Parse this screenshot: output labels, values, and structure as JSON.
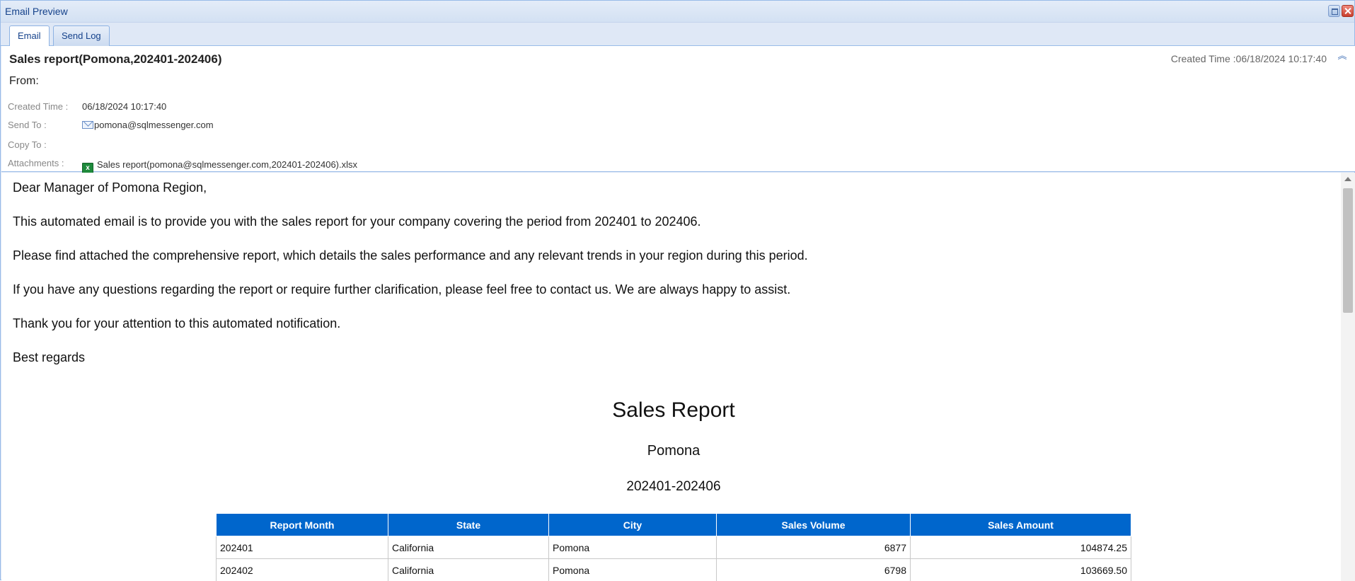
{
  "window": {
    "title": "Email Preview"
  },
  "tabs": [
    {
      "label": "Email",
      "active": true
    },
    {
      "label": "Send Log",
      "active": false
    }
  ],
  "header": {
    "subject": "Sales report(Pomona,202401-202406)",
    "created_right": "Created Time :06/18/2024 10:17:40",
    "from_label": "From:",
    "created_label": "Created Time :",
    "created_value": "06/18/2024 10:17:40",
    "send_to_label": "Send To :",
    "send_to_value": "pomona@sqlmessenger.com",
    "copy_to_label": "Copy To :",
    "copy_to_value": "",
    "attachments_label": "Attachments :",
    "attachment_name": "Sales report(pomona@sqlmessenger.com,202401-202406).xlsx"
  },
  "body": {
    "greeting": "Dear Manager of  Pomona   Region,",
    "p1": "This automated email is to provide you with the sales report for your company covering the period from  202401 to  202406.",
    "p2": "Please find attached the comprehensive report, which details the sales performance and any relevant trends in your region during this period.",
    "p3": "If you have any questions regarding the report or require further clarification, please feel free to contact us. We are always happy to assist.",
    "p4": "Thank you for your attention to this automated notification.",
    "p5": "Best regards"
  },
  "report": {
    "title": "Sales Report",
    "region": "Pomona",
    "period": "202401-202406",
    "columns": [
      "Report Month",
      "State",
      "City",
      "Sales Volume",
      "Sales Amount"
    ],
    "rows": [
      {
        "month": "202401",
        "state": "California",
        "city": "Pomona",
        "volume": "6877",
        "amount": "104874.25"
      },
      {
        "month": "202402",
        "state": "California",
        "city": "Pomona",
        "volume": "6798",
        "amount": "103669.50"
      }
    ]
  },
  "colors": {
    "accent": "#0066cc",
    "frame": "#99bbe8",
    "tab_text": "#15428b"
  }
}
